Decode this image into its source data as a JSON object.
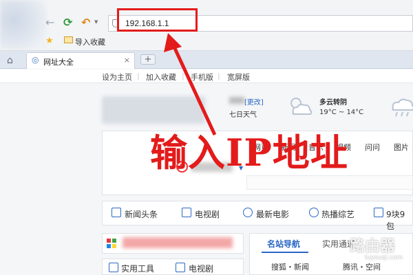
{
  "browser": {
    "address": "192.168.1.1",
    "favorites_label": "导入收藏",
    "tab_title": "网址大全",
    "new_tab_label": "+"
  },
  "topnav": {
    "items": [
      "设为主页",
      "加入收藏",
      "手机版",
      "宽屏版"
    ]
  },
  "weather": {
    "change_link": "[更改]",
    "week_label": "七日天气",
    "condition": "多云转阴",
    "temperature": "19°C ~ 14°C"
  },
  "search": {
    "tabs": [
      "网页",
      "新闻",
      "音乐",
      "视频",
      "问问",
      "图片"
    ]
  },
  "categories": [
    "新闻头条",
    "电视剧",
    "最新电影",
    "热播综艺",
    "9块9包"
  ],
  "lower": {
    "tools_label": "实用工具",
    "tv_label": "电视剧",
    "site_tab": "名站导航",
    "site_tab2": "实用通道",
    "links": [
      "搜狐・新闻",
      "腾讯・空间"
    ]
  },
  "annotation": {
    "instruction": "输入IP地址",
    "highlight_color": "#e31b1b"
  },
  "watermark": {
    "brand": "路由器",
    "url": "luyouqi.com"
  },
  "icons": [
    "back-icon",
    "refresh-icon",
    "undo-icon",
    "star-icon",
    "folder-icon",
    "home-icon",
    "globe-icon",
    "cloud-sun-icon",
    "rain-icon"
  ]
}
